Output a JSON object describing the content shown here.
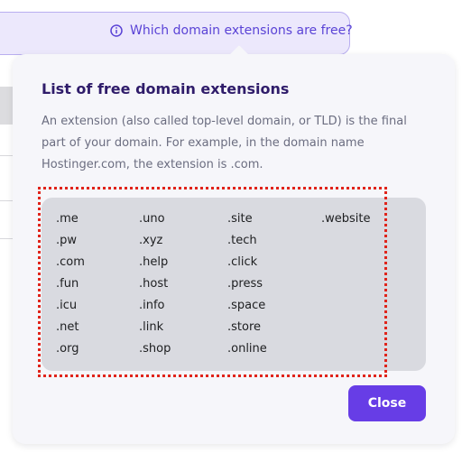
{
  "trigger": {
    "label": "Which domain extensions are free?",
    "icon": "info-icon"
  },
  "popover": {
    "title": "List of free domain extensions",
    "description": "An extension (also called top-level domain, or TLD) is the final part of your domain. For example, in the domain name Hostinger.com, the extension is .com.",
    "extension_columns": [
      [
        ".me",
        ".pw",
        ".com",
        ".fun",
        ".icu",
        ".net",
        ".org"
      ],
      [
        ".uno",
        ".xyz",
        ".help",
        ".host",
        ".info",
        ".link",
        ".shop"
      ],
      [
        ".site",
        ".tech",
        ".click",
        ".press",
        ".space",
        ".store",
        ".online"
      ],
      [
        ".website"
      ]
    ],
    "close_label": "Close"
  },
  "colors": {
    "accent": "#673de6",
    "trigger_bg": "#ece8fc",
    "trigger_text": "#5a43d6",
    "title": "#2f1c6a",
    "highlight": "#e0241b"
  }
}
